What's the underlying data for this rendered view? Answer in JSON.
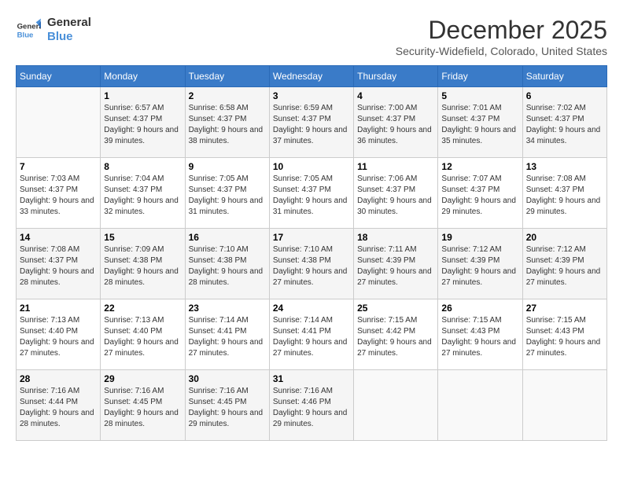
{
  "header": {
    "logo_line1": "General",
    "logo_line2": "Blue",
    "month_title": "December 2025",
    "location": "Security-Widefield, Colorado, United States"
  },
  "weekdays": [
    "Sunday",
    "Monday",
    "Tuesday",
    "Wednesday",
    "Thursday",
    "Friday",
    "Saturday"
  ],
  "weeks": [
    [
      {
        "day": "",
        "sunrise": "",
        "sunset": "",
        "daylight": ""
      },
      {
        "day": "1",
        "sunrise": "Sunrise: 6:57 AM",
        "sunset": "Sunset: 4:37 PM",
        "daylight": "Daylight: 9 hours and 39 minutes."
      },
      {
        "day": "2",
        "sunrise": "Sunrise: 6:58 AM",
        "sunset": "Sunset: 4:37 PM",
        "daylight": "Daylight: 9 hours and 38 minutes."
      },
      {
        "day": "3",
        "sunrise": "Sunrise: 6:59 AM",
        "sunset": "Sunset: 4:37 PM",
        "daylight": "Daylight: 9 hours and 37 minutes."
      },
      {
        "day": "4",
        "sunrise": "Sunrise: 7:00 AM",
        "sunset": "Sunset: 4:37 PM",
        "daylight": "Daylight: 9 hours and 36 minutes."
      },
      {
        "day": "5",
        "sunrise": "Sunrise: 7:01 AM",
        "sunset": "Sunset: 4:37 PM",
        "daylight": "Daylight: 9 hours and 35 minutes."
      },
      {
        "day": "6",
        "sunrise": "Sunrise: 7:02 AM",
        "sunset": "Sunset: 4:37 PM",
        "daylight": "Daylight: 9 hours and 34 minutes."
      }
    ],
    [
      {
        "day": "7",
        "sunrise": "Sunrise: 7:03 AM",
        "sunset": "Sunset: 4:37 PM",
        "daylight": "Daylight: 9 hours and 33 minutes."
      },
      {
        "day": "8",
        "sunrise": "Sunrise: 7:04 AM",
        "sunset": "Sunset: 4:37 PM",
        "daylight": "Daylight: 9 hours and 32 minutes."
      },
      {
        "day": "9",
        "sunrise": "Sunrise: 7:05 AM",
        "sunset": "Sunset: 4:37 PM",
        "daylight": "Daylight: 9 hours and 31 minutes."
      },
      {
        "day": "10",
        "sunrise": "Sunrise: 7:05 AM",
        "sunset": "Sunset: 4:37 PM",
        "daylight": "Daylight: 9 hours and 31 minutes."
      },
      {
        "day": "11",
        "sunrise": "Sunrise: 7:06 AM",
        "sunset": "Sunset: 4:37 PM",
        "daylight": "Daylight: 9 hours and 30 minutes."
      },
      {
        "day": "12",
        "sunrise": "Sunrise: 7:07 AM",
        "sunset": "Sunset: 4:37 PM",
        "daylight": "Daylight: 9 hours and 29 minutes."
      },
      {
        "day": "13",
        "sunrise": "Sunrise: 7:08 AM",
        "sunset": "Sunset: 4:37 PM",
        "daylight": "Daylight: 9 hours and 29 minutes."
      }
    ],
    [
      {
        "day": "14",
        "sunrise": "Sunrise: 7:08 AM",
        "sunset": "Sunset: 4:37 PM",
        "daylight": "Daylight: 9 hours and 28 minutes."
      },
      {
        "day": "15",
        "sunrise": "Sunrise: 7:09 AM",
        "sunset": "Sunset: 4:38 PM",
        "daylight": "Daylight: 9 hours and 28 minutes."
      },
      {
        "day": "16",
        "sunrise": "Sunrise: 7:10 AM",
        "sunset": "Sunset: 4:38 PM",
        "daylight": "Daylight: 9 hours and 28 minutes."
      },
      {
        "day": "17",
        "sunrise": "Sunrise: 7:10 AM",
        "sunset": "Sunset: 4:38 PM",
        "daylight": "Daylight: 9 hours and 27 minutes."
      },
      {
        "day": "18",
        "sunrise": "Sunrise: 7:11 AM",
        "sunset": "Sunset: 4:39 PM",
        "daylight": "Daylight: 9 hours and 27 minutes."
      },
      {
        "day": "19",
        "sunrise": "Sunrise: 7:12 AM",
        "sunset": "Sunset: 4:39 PM",
        "daylight": "Daylight: 9 hours and 27 minutes."
      },
      {
        "day": "20",
        "sunrise": "Sunrise: 7:12 AM",
        "sunset": "Sunset: 4:39 PM",
        "daylight": "Daylight: 9 hours and 27 minutes."
      }
    ],
    [
      {
        "day": "21",
        "sunrise": "Sunrise: 7:13 AM",
        "sunset": "Sunset: 4:40 PM",
        "daylight": "Daylight: 9 hours and 27 minutes."
      },
      {
        "day": "22",
        "sunrise": "Sunrise: 7:13 AM",
        "sunset": "Sunset: 4:40 PM",
        "daylight": "Daylight: 9 hours and 27 minutes."
      },
      {
        "day": "23",
        "sunrise": "Sunrise: 7:14 AM",
        "sunset": "Sunset: 4:41 PM",
        "daylight": "Daylight: 9 hours and 27 minutes."
      },
      {
        "day": "24",
        "sunrise": "Sunrise: 7:14 AM",
        "sunset": "Sunset: 4:41 PM",
        "daylight": "Daylight: 9 hours and 27 minutes."
      },
      {
        "day": "25",
        "sunrise": "Sunrise: 7:15 AM",
        "sunset": "Sunset: 4:42 PM",
        "daylight": "Daylight: 9 hours and 27 minutes."
      },
      {
        "day": "26",
        "sunrise": "Sunrise: 7:15 AM",
        "sunset": "Sunset: 4:43 PM",
        "daylight": "Daylight: 9 hours and 27 minutes."
      },
      {
        "day": "27",
        "sunrise": "Sunrise: 7:15 AM",
        "sunset": "Sunset: 4:43 PM",
        "daylight": "Daylight: 9 hours and 27 minutes."
      }
    ],
    [
      {
        "day": "28",
        "sunrise": "Sunrise: 7:16 AM",
        "sunset": "Sunset: 4:44 PM",
        "daylight": "Daylight: 9 hours and 28 minutes."
      },
      {
        "day": "29",
        "sunrise": "Sunrise: 7:16 AM",
        "sunset": "Sunset: 4:45 PM",
        "daylight": "Daylight: 9 hours and 28 minutes."
      },
      {
        "day": "30",
        "sunrise": "Sunrise: 7:16 AM",
        "sunset": "Sunset: 4:45 PM",
        "daylight": "Daylight: 9 hours and 29 minutes."
      },
      {
        "day": "31",
        "sunrise": "Sunrise: 7:16 AM",
        "sunset": "Sunset: 4:46 PM",
        "daylight": "Daylight: 9 hours and 29 minutes."
      },
      {
        "day": "",
        "sunrise": "",
        "sunset": "",
        "daylight": ""
      },
      {
        "day": "",
        "sunrise": "",
        "sunset": "",
        "daylight": ""
      },
      {
        "day": "",
        "sunrise": "",
        "sunset": "",
        "daylight": ""
      }
    ]
  ]
}
